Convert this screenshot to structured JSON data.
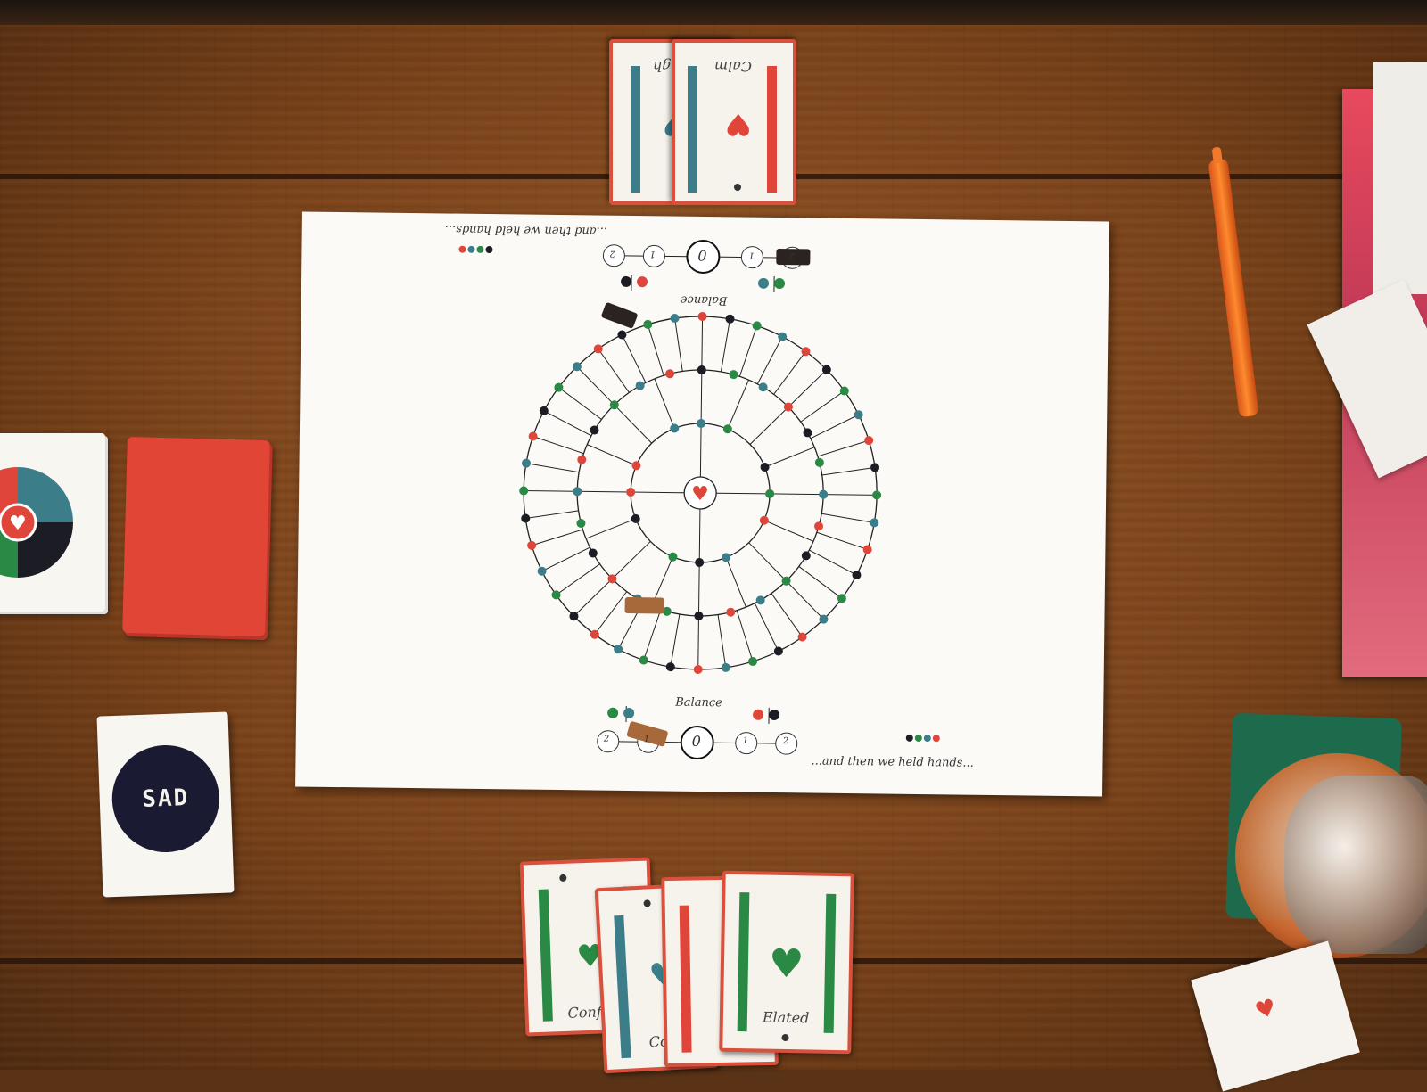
{
  "board": {
    "title_bottom": "...and then we held hands...",
    "title_top": "...and then we held hands...",
    "balance_label": "Balance",
    "track_numbers_bottom": [
      "2",
      "1",
      "0",
      "1",
      "2"
    ],
    "track_numbers_top": [
      "2",
      "1",
      "0",
      "1",
      "2"
    ],
    "center_icon": "heart-icon"
  },
  "cards_top": [
    {
      "word": "Laugh",
      "bar_color": "#3b7e8a",
      "heart_color": "#3b7e8a"
    },
    {
      "word": "Calm",
      "bar_color": "#e0453a",
      "heart_color": "#e0453a"
    }
  ],
  "cards_bottom": [
    {
      "word": "Conflict",
      "bar_color": "#2a8a45"
    },
    {
      "word": "Confused",
      "bar_color": "#3b7e8a"
    },
    {
      "word": "",
      "bar_color": "#e0453a"
    },
    {
      "word": "Elated",
      "bar_color": "#2a8a45"
    }
  ],
  "sad_card": {
    "label": "SAD"
  },
  "colors": {
    "red": "#e0453a",
    "teal": "#3b7e8a",
    "green": "#2a8a45",
    "black": "#1c1c24"
  }
}
